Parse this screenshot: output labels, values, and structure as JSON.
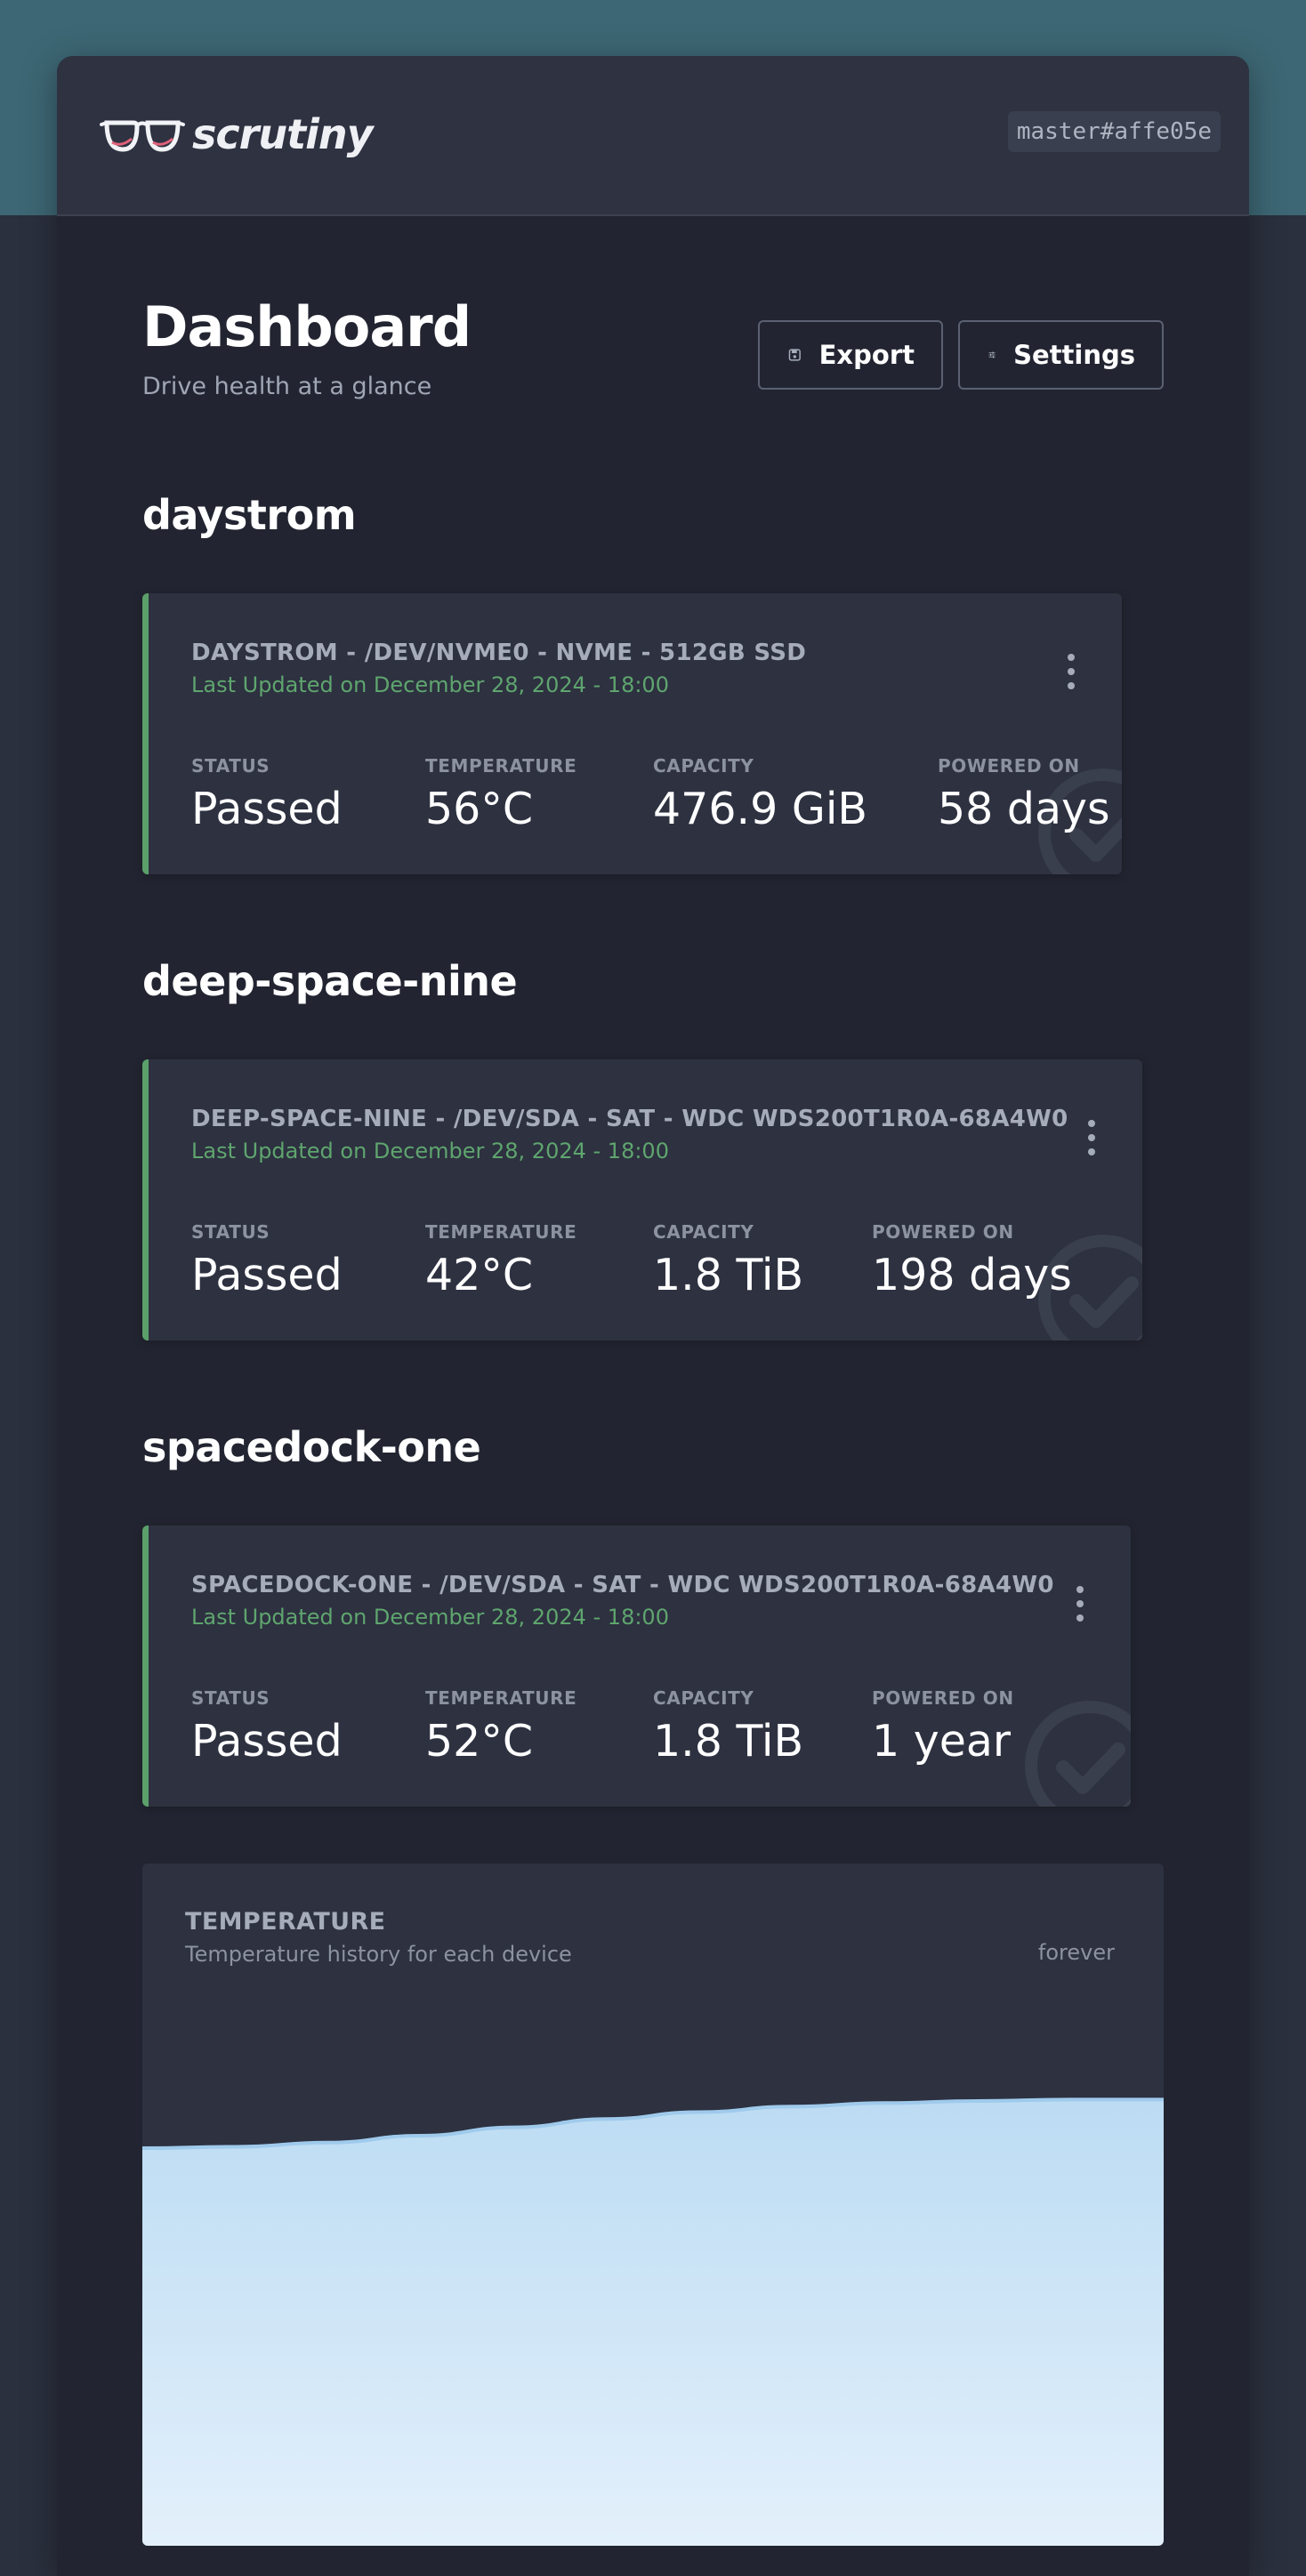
{
  "app": {
    "name": "scrutiny",
    "version": "master#affe05e"
  },
  "page": {
    "title": "Dashboard",
    "subtitle": "Drive health at a glance"
  },
  "toolbar": {
    "export_label": "Export",
    "settings_label": "Settings"
  },
  "groups": [
    {
      "host": "daystrom",
      "devices": [
        {
          "title": "DAYSTROM - /DEV/NVME0 - NVME - 512GB SSD",
          "updated": "Last Updated on December 28, 2024 - 18:00",
          "stats": [
            {
              "label": "STATUS",
              "value": "Passed"
            },
            {
              "label": "TEMPERATURE",
              "value": "56°C"
            },
            {
              "label": "CAPACITY",
              "value": "476.9 GiB"
            },
            {
              "label": "POWERED ON",
              "value": "58 days"
            }
          ]
        }
      ]
    },
    {
      "host": "deep-space-nine",
      "devices": [
        {
          "title": "DEEP-SPACE-NINE - /DEV/SDA - SAT - WDC WDS200T1R0A-68A4W0",
          "updated": "Last Updated on December 28, 2024 - 18:00",
          "stats": [
            {
              "label": "STATUS",
              "value": "Passed"
            },
            {
              "label": "TEMPERATURE",
              "value": "42°C"
            },
            {
              "label": "CAPACITY",
              "value": "1.8 TiB"
            },
            {
              "label": "POWERED ON",
              "value": "198 days"
            }
          ]
        }
      ]
    },
    {
      "host": "spacedock-one",
      "devices": [
        {
          "title": "SPACEDOCK-ONE - /DEV/SDA - SAT - WDC WDS200T1R0A-68A4W0",
          "updated": "Last Updated on December 28, 2024 - 18:00",
          "stats": [
            {
              "label": "STATUS",
              "value": "Passed"
            },
            {
              "label": "TEMPERATURE",
              "value": "52°C"
            },
            {
              "label": "CAPACITY",
              "value": "1.8 TiB"
            },
            {
              "label": "POWERED ON",
              "value": "1 year"
            }
          ]
        }
      ]
    }
  ],
  "temperature_chart": {
    "title": "TEMPERATURE",
    "subtitle": "Temperature history for each device",
    "range_label": "forever"
  },
  "colors": {
    "status_passed": "#5ba06a",
    "chart_fill_top": "#bcdcf3",
    "chart_fill_bottom": "#e3f0fb",
    "chart_line": "#9fcaec"
  },
  "icons": {
    "logo": "glasses-icon",
    "export": "floppy-disk-icon",
    "settings": "sliders-icon",
    "card_menu": "kebab-menu-icon",
    "status_badge": "check-circle-icon"
  },
  "chart_data": {
    "type": "area",
    "title": "TEMPERATURE",
    "subtitle": "Temperature history for each device",
    "xlabel": "",
    "ylabel": "",
    "grid": false,
    "series": [
      {
        "values": [
          0.0,
          0.02,
          0.08,
          0.18,
          0.3,
          0.42,
          0.52,
          0.6,
          0.65,
          0.68,
          0.7,
          0.7
        ]
      }
    ]
  }
}
